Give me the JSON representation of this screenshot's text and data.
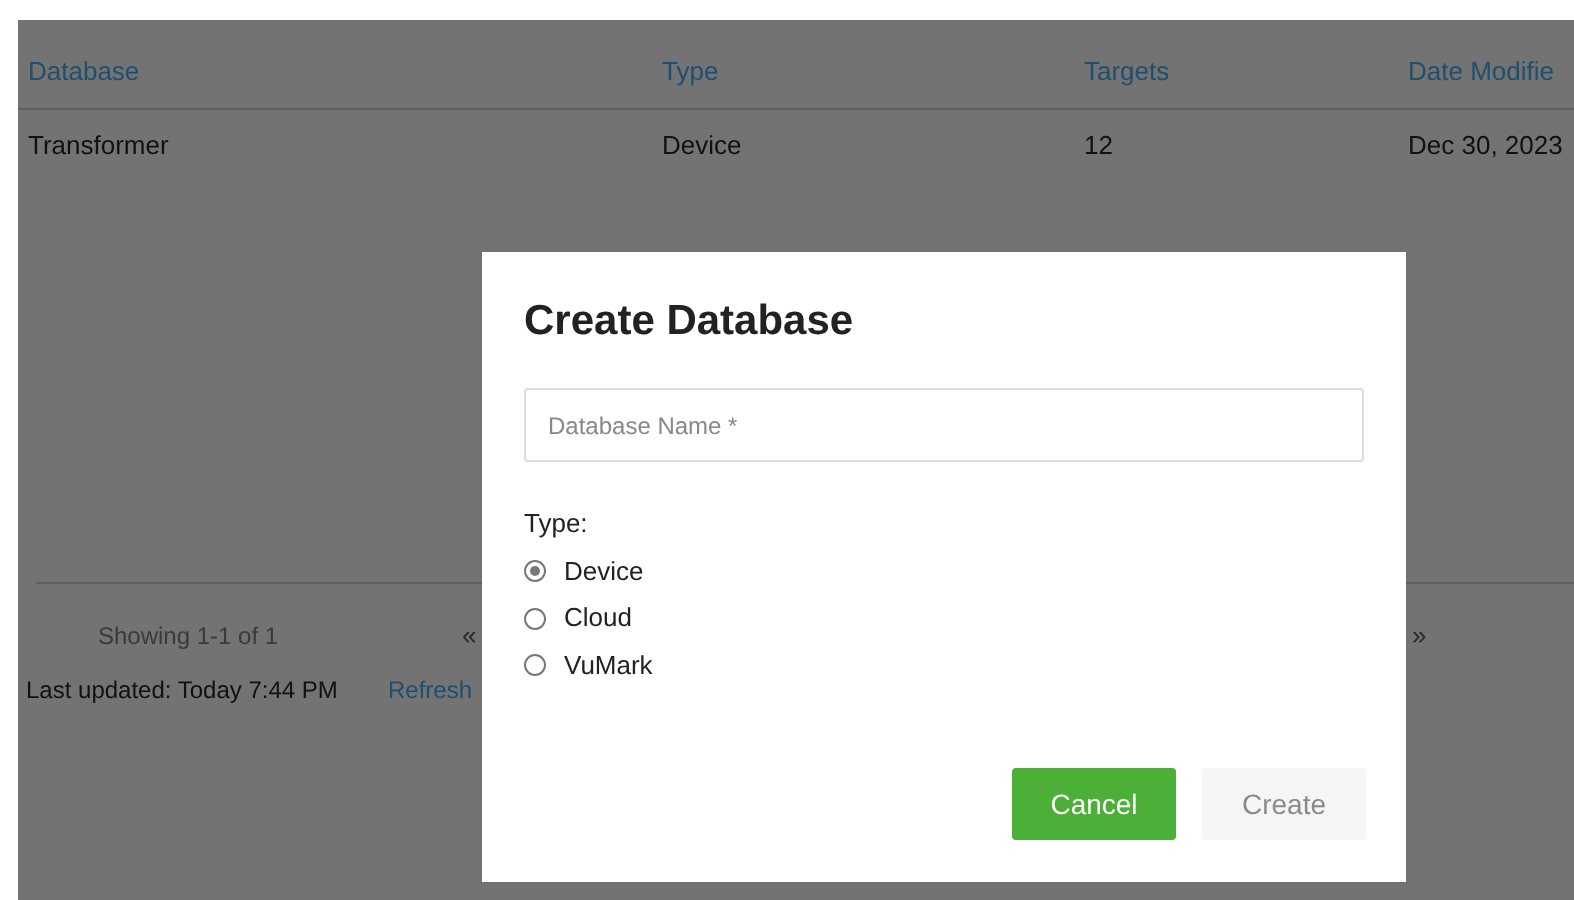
{
  "table": {
    "columns": [
      "Database",
      "Type",
      "Targets",
      "Date Modifie"
    ],
    "rows": [
      [
        "Transformer",
        "Device",
        "12",
        "Dec 30, 2023"
      ]
    ]
  },
  "pagination": {
    "summary": "Showing 1-1 of 1",
    "first": "«",
    "last": "»"
  },
  "footer": {
    "last_updated": "Last updated: Today 7:44 PM",
    "refresh": "Refresh"
  },
  "dialog": {
    "title": "Create Database",
    "name_field": {
      "placeholder": "Database Name *"
    },
    "type_label": "Type:",
    "options": [
      {
        "label": "Device",
        "selected": true
      },
      {
        "label": "Cloud",
        "selected": false
      },
      {
        "label": "VuMark",
        "selected": false
      }
    ],
    "buttons": [
      {
        "label": "Cancel",
        "disabled": false
      },
      {
        "label": "Create",
        "disabled": true
      }
    ]
  }
}
